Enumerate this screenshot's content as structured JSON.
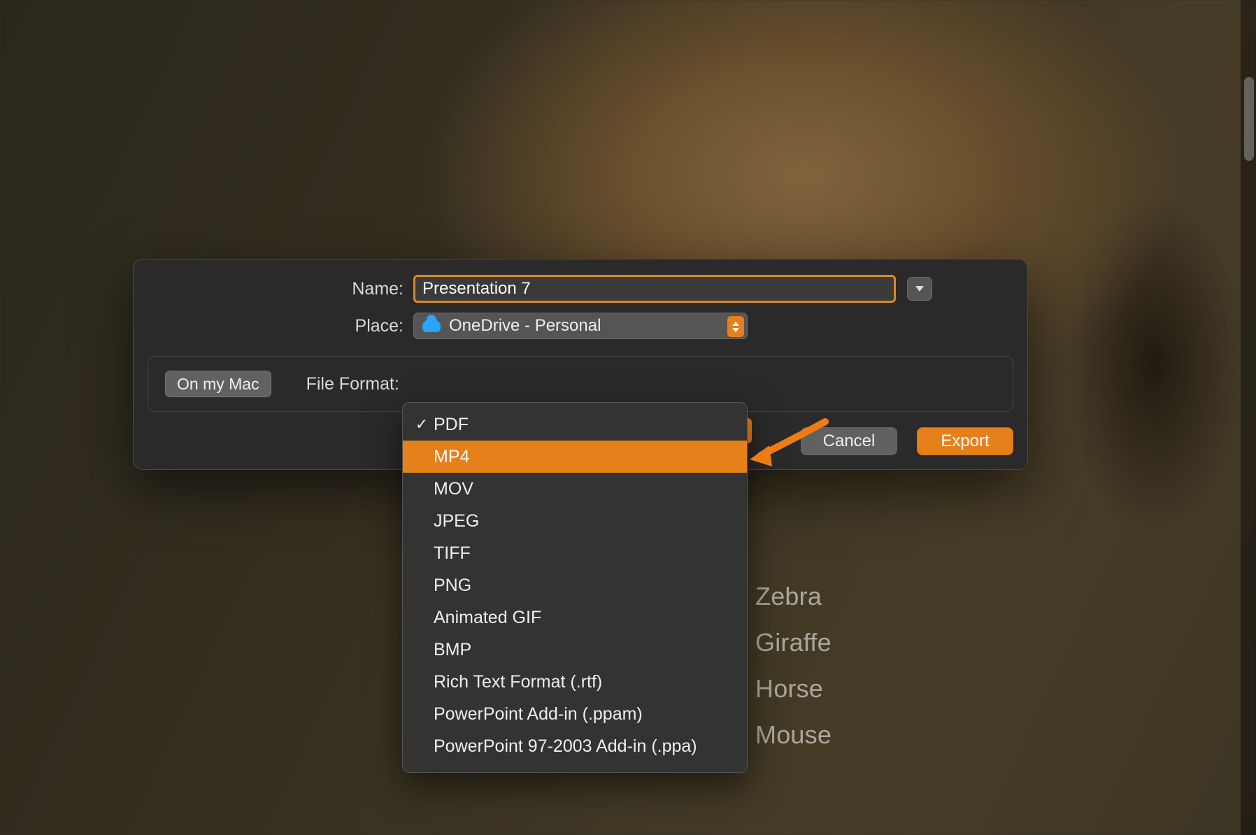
{
  "dialog": {
    "name_label": "Name:",
    "name_value": "Presentation 7",
    "place_label": "Place:",
    "place_value": "OneDrive - Personal",
    "on_my_mac": "On my Mac",
    "file_format_label": "File Format:",
    "cancel": "Cancel",
    "export": "Export"
  },
  "format_menu": {
    "selected_index": 0,
    "highlighted_index": 1,
    "items": [
      "PDF",
      "MP4",
      "MOV",
      "JPEG",
      "TIFF",
      "PNG",
      "Animated GIF",
      "BMP",
      "Rich Text Format (.rtf)",
      "PowerPoint Add-in (.ppam)",
      "PowerPoint 97-2003 Add-in (.ppa)"
    ]
  },
  "background_list": [
    "Zebra",
    "Giraffe",
    "Horse",
    "Mouse"
  ],
  "colors": {
    "accent": "#e6801a"
  }
}
